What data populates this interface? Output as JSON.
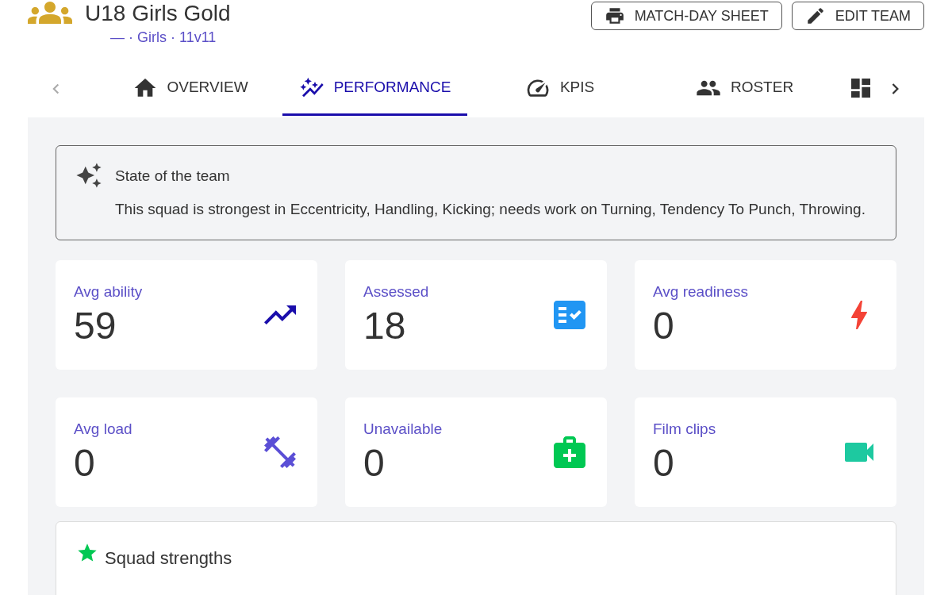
{
  "team": {
    "title": "U18 Girls Gold",
    "subtitle": "— · Girls · 11v11"
  },
  "actions": [
    {
      "label": "MATCH-DAY SHEET",
      "kind": "print"
    },
    {
      "label": "EDIT TEAM",
      "kind": "edit"
    }
  ],
  "tabs": [
    {
      "label": "OVERVIEW",
      "kind": "home",
      "selected": false
    },
    {
      "label": "PERFORMANCE",
      "kind": "graph",
      "selected": true
    },
    {
      "label": "KPIS",
      "kind": "gauge",
      "selected": false
    },
    {
      "label": "ROSTER",
      "kind": "people",
      "selected": false
    },
    {
      "kind": "dashboard",
      "selected": false
    }
  ],
  "summary": {
    "title": "State of the team",
    "text": "This squad is strongest in Eccentricity, Handling, Kicking; needs work on Turning, Tendency To Punch, Throwing."
  },
  "stats": [
    {
      "label": "Avg ability",
      "value": "59",
      "kind": "trend",
      "color": "#1a0dab"
    },
    {
      "label": "Assessed",
      "value": "18",
      "kind": "checklist",
      "color": "#2196f3"
    },
    {
      "label": "Avg readiness",
      "value": "0",
      "kind": "bolt",
      "color": "#f44336"
    },
    {
      "label": "Avg load",
      "value": "0",
      "kind": "dumbbell",
      "color": "#5b4fd6"
    },
    {
      "label": "Unavailable",
      "value": "0",
      "kind": "medical",
      "color": "#00c853"
    },
    {
      "label": "Film clips",
      "value": "0",
      "kind": "video",
      "color": "#1dc9a0"
    }
  ],
  "strengths": {
    "title": "Squad strengths"
  }
}
